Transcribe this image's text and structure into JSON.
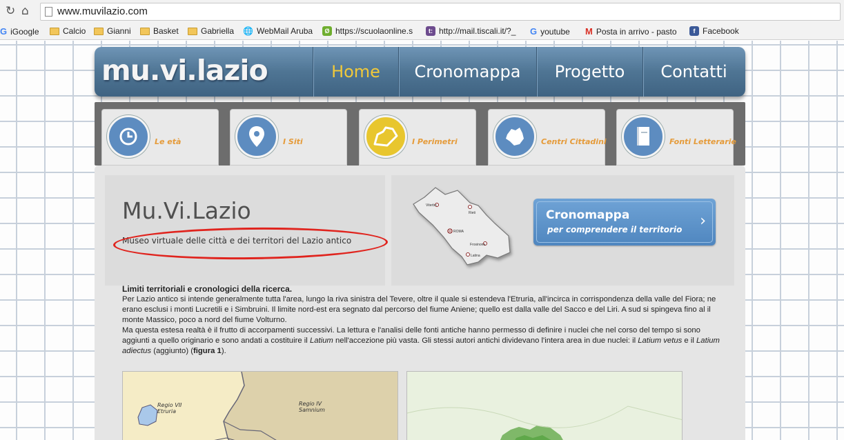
{
  "browser": {
    "url": "www.muvilazio.com",
    "bookmarks": [
      {
        "label": "iGoogle",
        "icon": "google-icon"
      },
      {
        "label": "Calcio",
        "icon": "folder-icon"
      },
      {
        "label": "Gianni",
        "icon": "folder-icon"
      },
      {
        "label": "Basket",
        "icon": "folder-icon"
      },
      {
        "label": "Gabriella",
        "icon": "folder-icon"
      },
      {
        "label": "WebMail Aruba",
        "icon": "aruba-icon"
      },
      {
        "label": "https://scuolaonline.s",
        "icon": "scuolaonline-icon"
      },
      {
        "label": "http://mail.tiscali.it/?_",
        "icon": "tiscali-icon"
      },
      {
        "label": "youtube",
        "icon": "google-icon"
      },
      {
        "label": "Posta in arrivo - pasto",
        "icon": "gmail-icon"
      },
      {
        "label": "Facebook",
        "icon": "facebook-icon"
      }
    ]
  },
  "header": {
    "logo": "mu.vi.lazio",
    "menu": [
      "Home",
      "Cronomappa",
      "Progetto",
      "Contatti"
    ],
    "active_menu": "Home"
  },
  "categories": [
    {
      "label": "Le età",
      "icon": "clock-icon"
    },
    {
      "label": "I Siti",
      "icon": "location-pin-icon"
    },
    {
      "label": "I Perimetri",
      "icon": "perimeter-icon"
    },
    {
      "label": "Centri Cittadini",
      "icon": "city-shape-icon"
    },
    {
      "label": "Fonti Letterarie",
      "icon": "book-icon"
    }
  ],
  "intro": {
    "title": "Mu.Vi.Lazio",
    "subtitle": "Museo virtuale delle città e dei territori del Lazio antico"
  },
  "map": {
    "cities": [
      "Viterbo",
      "Rieti",
      "ROMA",
      "Frosinone",
      "Latina"
    ]
  },
  "cronomappa_button": {
    "title": "Cronomappa",
    "subtitle": "per comprendere il territorio"
  },
  "article": {
    "heading": "Limiti territoriali e cronologici della ricerca.",
    "p1": "Per Lazio antico si intende generalmente tutta l'area, lungo la riva sinistra del Tevere, oltre il quale si estendeva l'Etruria, all'incirca in corrispondenza della valle del Fiora; ne erano esclusi i monti Lucretili e i Simbruini. Il limite nord-est era segnato dal percorso del fiume Aniene; quello est dalla valle del Sacco e del Liri. A sud si spingeva fino al il monte Massico, poco a nord del fiume Volturno.",
    "p2_a": "Ma questa estesa realtà è il frutto di accorpamenti successivi. La lettura e l'analisi delle fonti antiche hanno permesso di definire i nuclei che nel corso del tempo si sono aggiunti a quello originario e sono andati a costituire il ",
    "p2_latium": "Latium",
    "p2_b": " nell'accezione più vasta. Gli stessi autori antichi dividevano l'intera area in due nuclei: il ",
    "p2_vetus": "Latium vetus",
    "p2_c": " e il ",
    "p2_adiectus": "Latium adiectus",
    "p2_d": " (aggiunto) (",
    "p2_fig": "figura 1",
    "p2_e": ")."
  },
  "figure1": {
    "labels": [
      "Regio VII",
      "Etruria",
      "Regio IV",
      "Samnium"
    ]
  }
}
